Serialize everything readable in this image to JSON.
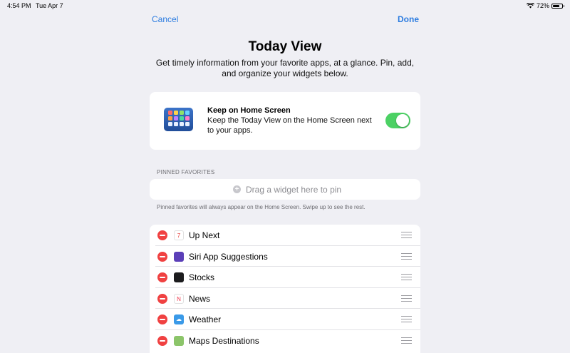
{
  "status_bar": {
    "time": "4:54 PM",
    "date": "Tue Apr 7",
    "battery": "72%",
    "battery_level": 0.72
  },
  "nav": {
    "cancel": "Cancel",
    "done": "Done"
  },
  "header": {
    "title": "Today View",
    "subtitle": "Get timely information from your favorite apps, at a glance. Pin, add, and organize your widgets below."
  },
  "keep_on_home": {
    "title": "Keep on Home Screen",
    "description": "Keep the Today View on the Home Screen next to your apps.",
    "toggle_on": true
  },
  "pinned": {
    "header": "PINNED FAVORITES",
    "drop_placeholder": "Drag a widget here to pin",
    "footer": "Pinned favorites will always appear on the Home Screen. Swipe up to see the rest."
  },
  "widgets": [
    {
      "label": "Up Next",
      "icon": "calendar-icon",
      "icon_text": "7",
      "icon_color": "#ffffff",
      "text_color": "#e53935"
    },
    {
      "label": "Siri App Suggestions",
      "icon": "siri-icon",
      "icon_text": "",
      "icon_color": "#5b3fb8",
      "text_color": "#ffffff"
    },
    {
      "label": "Stocks",
      "icon": "stocks-icon",
      "icon_text": "",
      "icon_color": "#1c1c1e",
      "text_color": "#ffffff"
    },
    {
      "label": "News",
      "icon": "news-icon",
      "icon_text": "N",
      "icon_color": "#ffffff",
      "text_color": "#f0364a"
    },
    {
      "label": "Weather",
      "icon": "weather-icon",
      "icon_text": "☁",
      "icon_color": "#3a9ae8",
      "text_color": "#ffffff"
    },
    {
      "label": "Maps Destinations",
      "icon": "maps-icon",
      "icon_text": "",
      "icon_color": "#8cc56a",
      "text_color": "#ffffff"
    }
  ]
}
